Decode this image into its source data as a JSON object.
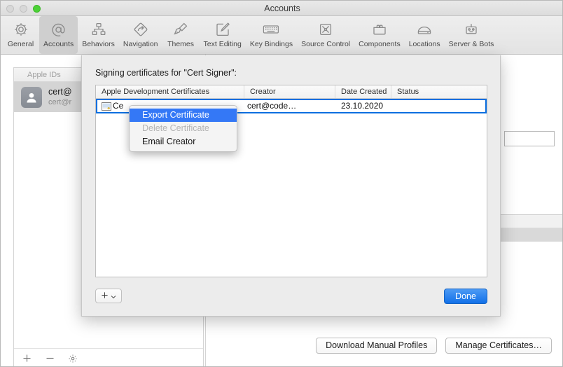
{
  "window": {
    "title": "Accounts",
    "traffic_lights": [
      "close-button",
      "minimize-button",
      "zoom-button"
    ]
  },
  "toolbar": {
    "items": [
      {
        "label": "General",
        "icon": "gear-icon",
        "selected": false
      },
      {
        "label": "Accounts",
        "icon": "at-sign-icon",
        "selected": true
      },
      {
        "label": "Behaviors",
        "icon": "hierarchy-icon",
        "selected": false
      },
      {
        "label": "Navigation",
        "icon": "diamond-arrow-icon",
        "selected": false
      },
      {
        "label": "Themes",
        "icon": "paintbrush-icon",
        "selected": false
      },
      {
        "label": "Text Editing",
        "icon": "pencil-square-icon",
        "selected": false
      },
      {
        "label": "Key Bindings",
        "icon": "keyboard-icon",
        "selected": false
      },
      {
        "label": "Source Control",
        "icon": "branch-square-icon",
        "selected": false
      },
      {
        "label": "Components",
        "icon": "toolbox-icon",
        "selected": false
      },
      {
        "label": "Locations",
        "icon": "disk-drive-icon",
        "selected": false
      },
      {
        "label": "Server & Bots",
        "icon": "robot-icon",
        "selected": false
      }
    ]
  },
  "sidebar": {
    "header": "Apple IDs",
    "account": {
      "primary": "cert@",
      "secondary": "cert@r",
      "avatar_icon": "user-avatar-icon"
    },
    "footer": {
      "add": "+",
      "remove": "−",
      "settings_icon": "gear-icon"
    }
  },
  "detail": {
    "download_manual_profiles": "Download Manual Profiles",
    "manage_certificates": "Manage Certificates…"
  },
  "sheet": {
    "title": "Signing certificates for \"Cert Signer\":",
    "table": {
      "columns": [
        "Apple Development Certificates",
        "Creator",
        "Date Created",
        "Status"
      ],
      "rows": [
        {
          "name": "Ce",
          "creator": "cert@code…",
          "date_created": "23.10.2020",
          "status": "",
          "icon": "certificate-icon",
          "selected": true
        }
      ]
    },
    "add_button": {
      "plus": "+",
      "chevron": "chevron-down-icon"
    },
    "done_button": "Done"
  },
  "context_menu": {
    "items": [
      {
        "label": "Export Certificate",
        "state": "highlighted"
      },
      {
        "label": "Delete Certificate",
        "state": "disabled"
      },
      {
        "label": "Email Creator",
        "state": "normal"
      }
    ]
  },
  "colors": {
    "accent_blue": "#3478f6",
    "selection_border": "#0b6fe0",
    "done_button_blue": "#1270e8",
    "zoom_green": "#4cd137"
  }
}
